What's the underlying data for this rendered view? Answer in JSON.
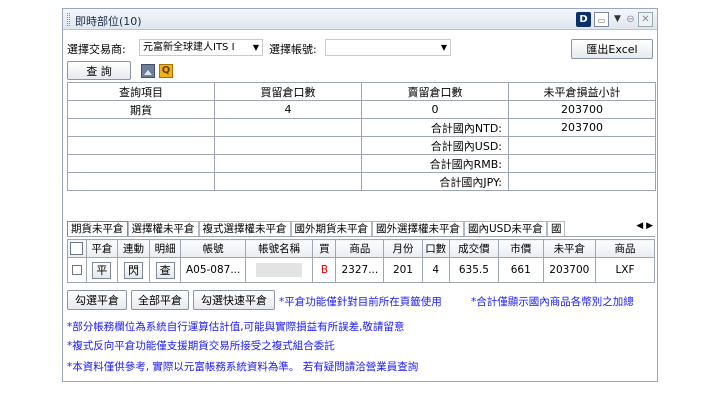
{
  "window": {
    "title": "即時部位(10)",
    "icons": [
      "d-icon",
      "document-icon",
      "dropdown-arrow-icon",
      "pin-icon",
      "close-icon"
    ]
  },
  "toolbar": {
    "broker_label": "選擇交易商:",
    "broker_value": "元富新全球建人ITS I​",
    "account_label": "選擇帳號:",
    "account_value": "",
    "export_label": "匯出Excel",
    "query_label": "查 詢"
  },
  "summary": {
    "headers": [
      "查詢項目",
      "買留倉口數",
      "賣留倉口數",
      "未平倉損益小計"
    ],
    "row": {
      "item": "期貨",
      "buy": "4",
      "sell": "0",
      "pnl": "203700"
    },
    "totals": [
      {
        "label": "合計國內NTD:",
        "value": "203700"
      },
      {
        "label": "合計國內USD:",
        "value": ""
      },
      {
        "label": "合計國內RMB:",
        "value": ""
      },
      {
        "label": "合計國內JPY:",
        "value": ""
      }
    ]
  },
  "tabs": [
    "期貨未平倉",
    "選擇權未平倉",
    "複式選擇權未平倉",
    "國外期貨未平倉",
    "國外選擇權未平倉",
    "國內USD未平倉",
    "國"
  ],
  "tab_nav": "◀ ▶",
  "grid": {
    "headers": [
      "",
      "平倉",
      "連動",
      "明細",
      "帳號",
      "帳號名稱",
      "買",
      "商品",
      "月份",
      "口數",
      "成交價",
      "市價",
      "未平倉",
      "商品"
    ],
    "row": {
      "close_btn": "平",
      "link_btn": "閃",
      "detail_btn": "查",
      "account": "A05-087...",
      "side": "B",
      "product": "2327...",
      "month": "201",
      "qty": "4",
      "price": "635.5",
      "market": "661",
      "unrealized": "203700",
      "symbol": "LXF"
    }
  },
  "actions": {
    "select_close": "勾選平倉",
    "close_all": "全部平倉",
    "select_quick_close": "勾選快速平倉"
  },
  "notes": {
    "n1": "*平倉功能僅針對目前所在頁籤使用",
    "n2": "*合計僅顯示國內商品各幣別之加總",
    "n3": "*部分帳務欄位為系統自行運算估計值,可能與實際損益有所誤差,敬請留意",
    "n4": "*複式反向平倉功能僅支援期貨交易所接受之複式組合委託",
    "n5": "*本資料僅供參考, 實際以元富帳務系統資料為準。 若有疑問請洽營業員查詢"
  }
}
